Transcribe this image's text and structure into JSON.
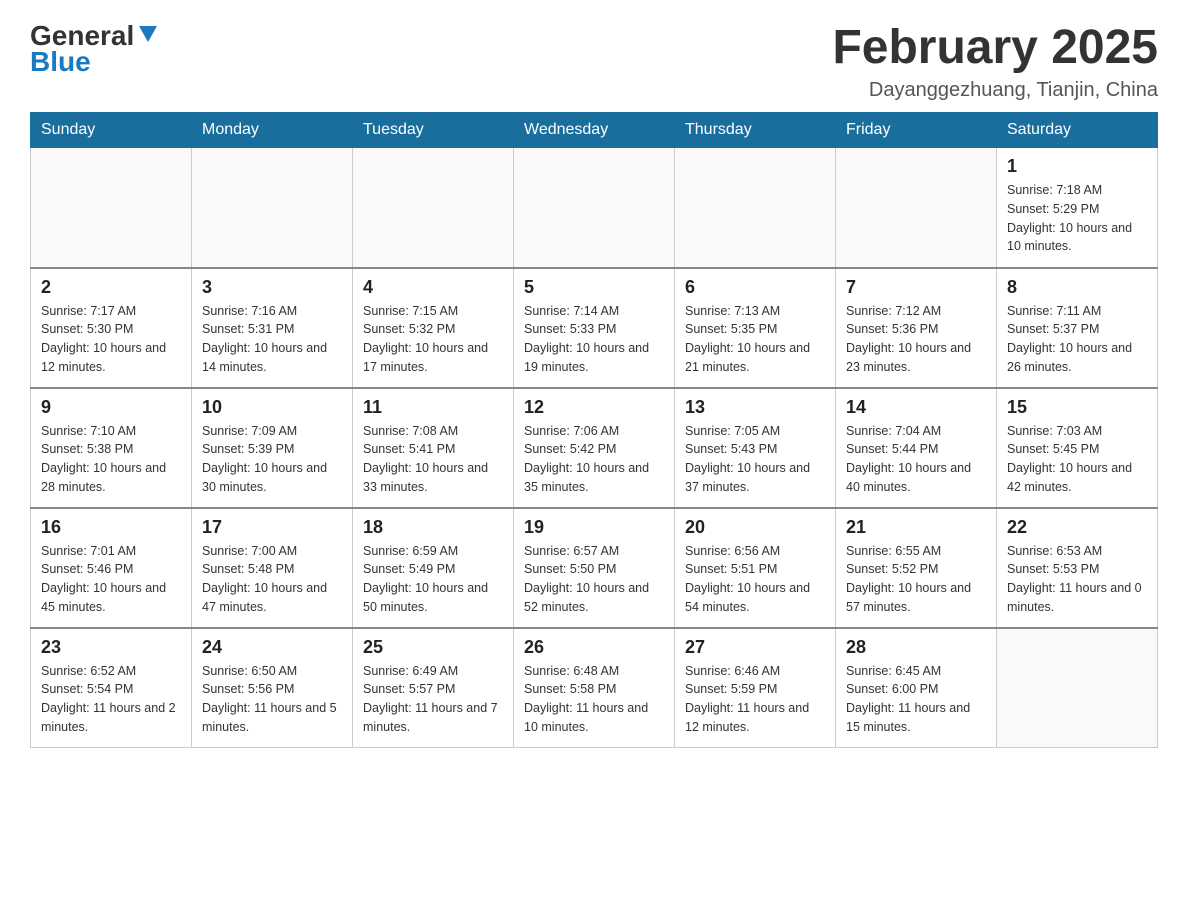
{
  "logo": {
    "general": "General",
    "blue": "Blue",
    "triangle": "▶"
  },
  "header": {
    "month": "February 2025",
    "location": "Dayanggezhuang, Tianjin, China"
  },
  "weekdays": [
    "Sunday",
    "Monday",
    "Tuesday",
    "Wednesday",
    "Thursday",
    "Friday",
    "Saturday"
  ],
  "weeks": [
    [
      {
        "day": "",
        "info": ""
      },
      {
        "day": "",
        "info": ""
      },
      {
        "day": "",
        "info": ""
      },
      {
        "day": "",
        "info": ""
      },
      {
        "day": "",
        "info": ""
      },
      {
        "day": "",
        "info": ""
      },
      {
        "day": "1",
        "info": "Sunrise: 7:18 AM\nSunset: 5:29 PM\nDaylight: 10 hours and 10 minutes."
      }
    ],
    [
      {
        "day": "2",
        "info": "Sunrise: 7:17 AM\nSunset: 5:30 PM\nDaylight: 10 hours and 12 minutes."
      },
      {
        "day": "3",
        "info": "Sunrise: 7:16 AM\nSunset: 5:31 PM\nDaylight: 10 hours and 14 minutes."
      },
      {
        "day": "4",
        "info": "Sunrise: 7:15 AM\nSunset: 5:32 PM\nDaylight: 10 hours and 17 minutes."
      },
      {
        "day": "5",
        "info": "Sunrise: 7:14 AM\nSunset: 5:33 PM\nDaylight: 10 hours and 19 minutes."
      },
      {
        "day": "6",
        "info": "Sunrise: 7:13 AM\nSunset: 5:35 PM\nDaylight: 10 hours and 21 minutes."
      },
      {
        "day": "7",
        "info": "Sunrise: 7:12 AM\nSunset: 5:36 PM\nDaylight: 10 hours and 23 minutes."
      },
      {
        "day": "8",
        "info": "Sunrise: 7:11 AM\nSunset: 5:37 PM\nDaylight: 10 hours and 26 minutes."
      }
    ],
    [
      {
        "day": "9",
        "info": "Sunrise: 7:10 AM\nSunset: 5:38 PM\nDaylight: 10 hours and 28 minutes."
      },
      {
        "day": "10",
        "info": "Sunrise: 7:09 AM\nSunset: 5:39 PM\nDaylight: 10 hours and 30 minutes."
      },
      {
        "day": "11",
        "info": "Sunrise: 7:08 AM\nSunset: 5:41 PM\nDaylight: 10 hours and 33 minutes."
      },
      {
        "day": "12",
        "info": "Sunrise: 7:06 AM\nSunset: 5:42 PM\nDaylight: 10 hours and 35 minutes."
      },
      {
        "day": "13",
        "info": "Sunrise: 7:05 AM\nSunset: 5:43 PM\nDaylight: 10 hours and 37 minutes."
      },
      {
        "day": "14",
        "info": "Sunrise: 7:04 AM\nSunset: 5:44 PM\nDaylight: 10 hours and 40 minutes."
      },
      {
        "day": "15",
        "info": "Sunrise: 7:03 AM\nSunset: 5:45 PM\nDaylight: 10 hours and 42 minutes."
      }
    ],
    [
      {
        "day": "16",
        "info": "Sunrise: 7:01 AM\nSunset: 5:46 PM\nDaylight: 10 hours and 45 minutes."
      },
      {
        "day": "17",
        "info": "Sunrise: 7:00 AM\nSunset: 5:48 PM\nDaylight: 10 hours and 47 minutes."
      },
      {
        "day": "18",
        "info": "Sunrise: 6:59 AM\nSunset: 5:49 PM\nDaylight: 10 hours and 50 minutes."
      },
      {
        "day": "19",
        "info": "Sunrise: 6:57 AM\nSunset: 5:50 PM\nDaylight: 10 hours and 52 minutes."
      },
      {
        "day": "20",
        "info": "Sunrise: 6:56 AM\nSunset: 5:51 PM\nDaylight: 10 hours and 54 minutes."
      },
      {
        "day": "21",
        "info": "Sunrise: 6:55 AM\nSunset: 5:52 PM\nDaylight: 10 hours and 57 minutes."
      },
      {
        "day": "22",
        "info": "Sunrise: 6:53 AM\nSunset: 5:53 PM\nDaylight: 11 hours and 0 minutes."
      }
    ],
    [
      {
        "day": "23",
        "info": "Sunrise: 6:52 AM\nSunset: 5:54 PM\nDaylight: 11 hours and 2 minutes."
      },
      {
        "day": "24",
        "info": "Sunrise: 6:50 AM\nSunset: 5:56 PM\nDaylight: 11 hours and 5 minutes."
      },
      {
        "day": "25",
        "info": "Sunrise: 6:49 AM\nSunset: 5:57 PM\nDaylight: 11 hours and 7 minutes."
      },
      {
        "day": "26",
        "info": "Sunrise: 6:48 AM\nSunset: 5:58 PM\nDaylight: 11 hours and 10 minutes."
      },
      {
        "day": "27",
        "info": "Sunrise: 6:46 AM\nSunset: 5:59 PM\nDaylight: 11 hours and 12 minutes."
      },
      {
        "day": "28",
        "info": "Sunrise: 6:45 AM\nSunset: 6:00 PM\nDaylight: 11 hours and 15 minutes."
      },
      {
        "day": "",
        "info": ""
      }
    ]
  ]
}
